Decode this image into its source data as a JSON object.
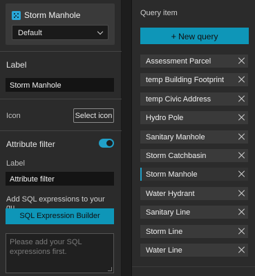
{
  "layer": {
    "name": "Storm Manhole",
    "select_value": "Default"
  },
  "label_section": {
    "heading": "Label",
    "value": "Storm Manhole"
  },
  "icon_section": {
    "heading": "Icon",
    "button": "Select icon"
  },
  "attribute_filter": {
    "heading": "Attribute filter",
    "enabled": true,
    "label_heading": "Label",
    "label_value": "Attribute filter",
    "hint": "Add SQL expressions to your qu...",
    "builder_button": "SQL Expression Builder",
    "placeholder": "Please add your SQL expressions first."
  },
  "query_panel": {
    "title": "Query item",
    "new_query_label": "New query",
    "items": [
      {
        "label": "Assessment Parcel"
      },
      {
        "label": "temp Building Footprint"
      },
      {
        "label": "temp Civic Address"
      },
      {
        "label": "Hydro Pole"
      },
      {
        "label": "Sanitary Manhole"
      },
      {
        "label": "Storm Catchbasin"
      },
      {
        "label": "Storm Manhole"
      },
      {
        "label": "Water Hydrant"
      },
      {
        "label": "Sanitary Line"
      },
      {
        "label": "Storm Line"
      },
      {
        "label": "Water Line"
      }
    ],
    "active_index": 6
  },
  "colors": {
    "accent": "#0e96b8",
    "background": "#1d1d1d",
    "panel": "#2b2b2b"
  }
}
